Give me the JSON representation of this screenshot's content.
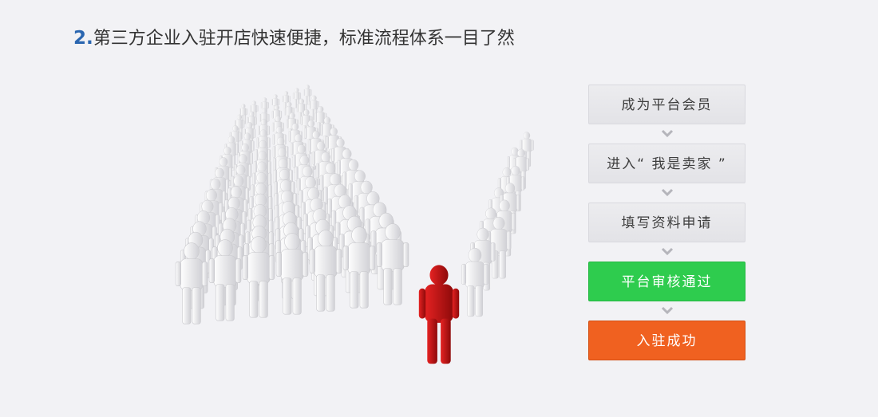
{
  "headline": {
    "number": "2.",
    "text": "第三方企业入驻开店快速便捷，标准流程体系一目了然"
  },
  "steps": [
    {
      "label": "成为平台会员",
      "style": "gray"
    },
    {
      "label": "进入“ 我是卖家 ”",
      "style": "gray"
    },
    {
      "label": "填写资料申请",
      "style": "gray"
    },
    {
      "label": "平台审核通过",
      "style": "green"
    },
    {
      "label": "入驻成功",
      "style": "orange"
    }
  ],
  "colors": {
    "background": "#f2f2f5",
    "headline_number": "#2a66b0",
    "step_gray": "#e6e6ea",
    "step_green": "#2ecc4e",
    "step_orange": "#f06120",
    "arrow": "#b5b5bb",
    "leader_figure": "#cc1414",
    "crowd_figure": "#e8e8ea"
  },
  "illustration": {
    "description_icon": "crowd-arrow-with-red-leader"
  }
}
